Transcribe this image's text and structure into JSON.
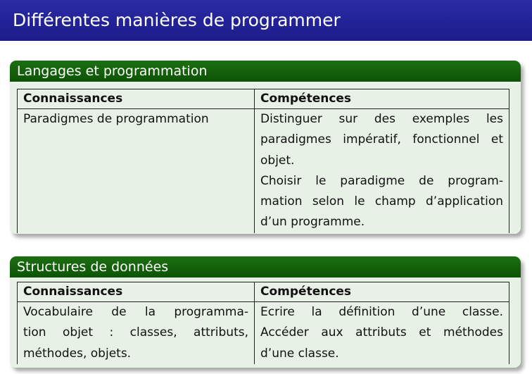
{
  "slide": {
    "title": "Différentes manières de programmer"
  },
  "blocks": [
    {
      "title": "Langages et programmation",
      "headers": [
        "Connaissances",
        "Compétences"
      ],
      "knowledge": [
        "Paradigmes de programmation"
      ],
      "skills": [
        "Distinguer sur des exemples les",
        "paradigmes impératif, fonctionnel et",
        "objet.",
        "Choisir le paradigme de program-",
        "mation selon le champ d’application",
        "d’un programme."
      ]
    },
    {
      "title": "Structures de données",
      "headers": [
        "Connaissances",
        "Compétences"
      ],
      "knowledge": [
        "Vocabulaire de la programma-",
        "tion objet : classes, attributs,",
        "méthodes, objets."
      ],
      "skills": [
        "Ecrire la définition d’une classe.",
        "Accéder aux attributs et méthodes",
        "d’une classe."
      ]
    }
  ],
  "colors": {
    "frametitle_bg": "#1c1c8a",
    "block_title_bg": "#0c5305",
    "block_body_bg": "#e7f1e5"
  }
}
